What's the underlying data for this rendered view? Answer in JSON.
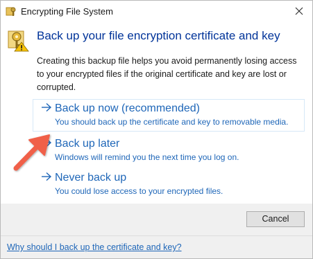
{
  "window": {
    "title": "Encrypting File System",
    "icon": "certificate-key-icon",
    "close_icon": "close-icon"
  },
  "header": {
    "icon": "certificate-key-warning-icon",
    "heading": "Back up your file encryption certificate and key",
    "description": "Creating this backup file helps you avoid permanently losing access to your encrypted files if the original certificate and key are lost or corrupted."
  },
  "options": [
    {
      "icon": "arrow-right-icon",
      "title": "Back up now (recommended)",
      "subtitle": "You should back up the certificate and key to removable media."
    },
    {
      "icon": "arrow-right-icon",
      "title": "Back up later",
      "subtitle": "Windows will remind you the next time you log on."
    },
    {
      "icon": "arrow-right-icon",
      "title": "Never back up",
      "subtitle": "You could lose access to your encrypted files."
    }
  ],
  "annotation": {
    "icon": "red-pointer-arrow-icon",
    "color": "#f0604a"
  },
  "footer": {
    "cancel_label": "Cancel",
    "help_link": "Why should I back up the certificate and key?"
  },
  "colors": {
    "heading": "#003399",
    "link": "#1e66b8",
    "footer_bg": "#f0f0f0",
    "highlight_border": "#d6e8f7"
  }
}
